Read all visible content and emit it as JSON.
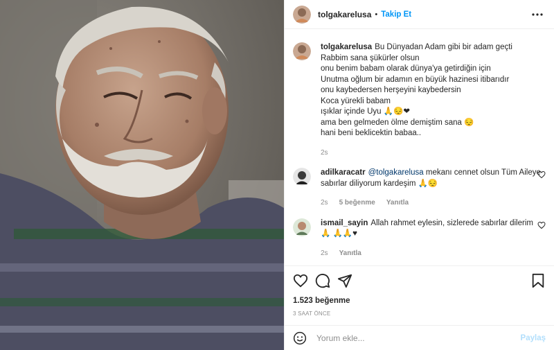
{
  "header": {
    "username": "tolgakarelusa",
    "separator": "•",
    "follow_label": "Takip Et"
  },
  "caption": {
    "username": "tolgakarelusa",
    "lines": [
      "Bu Dünyadan Adam gibi bir adam geçti",
      "Rabbim sana şükürler olsun",
      "onu benim babam olarak dünya'ya getirdiğin için",
      "Unutma oğlum bir adamın en büyük hazinesi itibarıdır",
      "onu kaybedersen herşeyini kaybedersin",
      "Koca yürekli babam",
      "ışıklar içinde Uyu",
      "ama ben gelmeden ölme demiştim sana",
      "hani beni beklicektin babaa.."
    ],
    "emoji_line7": "🙏😔❤",
    "emoji_line8": "😔",
    "age": "2s"
  },
  "comments": [
    {
      "username": "adilkaracatr",
      "mention": "@tolgakarelusa",
      "text": "mekanı cennet olsun Tüm Aileye sabırlar diliyorum kardeşim",
      "emoji": "🙏😔",
      "age": "2s",
      "likes": "5 beğenme",
      "reply": "Yanıtla"
    },
    {
      "username": "ismail_sayin",
      "text": "Allah rahmet eylesin, sizlerede sabırlar dilerim",
      "emoji": "🙏 🙏🙏♥",
      "age": "2s",
      "reply": "Yanıtla"
    }
  ],
  "likes_count": "1.523 beğenme",
  "post_time": "3 SAAT ÖNCE",
  "add_comment": {
    "placeholder": "Yorum ekle...",
    "share_label": "Paylaş"
  },
  "colors": {
    "accent": "#0095f6",
    "text": "#262626",
    "muted": "#8e8e8e",
    "share_disabled": "#b2dffc"
  },
  "icons": [
    "more-icon",
    "heart-icon",
    "comment-icon",
    "share-icon",
    "save-icon",
    "emoji-icon"
  ]
}
